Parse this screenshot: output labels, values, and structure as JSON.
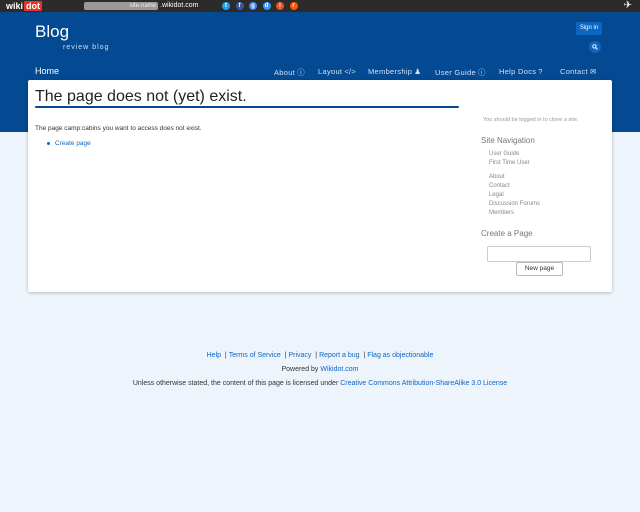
{
  "topbar": {
    "logo_wiki": "wiki",
    "logo_dot": "dot",
    "site_name_placeholder": "site-name",
    "domain_suffix": ".wikidot.com",
    "social_icons": [
      {
        "name": "twitter-icon",
        "color": "#1da1f2",
        "glyph": "t"
      },
      {
        "name": "facebook-icon",
        "color": "#3b5998",
        "glyph": "f"
      },
      {
        "name": "google-icon",
        "color": "#4285f4",
        "glyph": "g"
      },
      {
        "name": "delicious-icon",
        "color": "#3399ff",
        "glyph": "d"
      },
      {
        "name": "digg-icon",
        "color": "#e8532a",
        "glyph": "i"
      },
      {
        "name": "reddit-icon",
        "color": "#ff5700",
        "glyph": "r"
      }
    ]
  },
  "header": {
    "title": "Blog",
    "subtitle": "review blog",
    "signin_label": "Sign in",
    "accent": "#034a93"
  },
  "nav": {
    "home": "Home",
    "items": [
      {
        "label": "About",
        "icon": "info-icon",
        "glyph": "i"
      },
      {
        "label": "Layout",
        "icon": "code-icon",
        "glyph": "</>"
      },
      {
        "label": "Membership",
        "icon": "user-icon",
        "glyph": "♟"
      },
      {
        "label": "User Guide",
        "icon": "info-icon",
        "glyph": "i"
      },
      {
        "label": "Help Docs",
        "icon": "question-icon",
        "glyph": "?"
      },
      {
        "label": "Contact",
        "icon": "envelope-icon",
        "glyph": "✉"
      }
    ]
  },
  "main": {
    "title": "The page does not (yet) exist.",
    "body": "The page camp:cabins you want to access does not exist.",
    "create_link": "Create page"
  },
  "sidebar": {
    "login_note": "You should be logged in to clone a site.",
    "nav_heading": "Site Navigation",
    "links_group1": [
      "User Guide",
      "First Time User"
    ],
    "links_group2": [
      "About",
      "Contact",
      "Legal",
      "Discussion Forums",
      "Members"
    ],
    "create_heading": "Create a Page",
    "new_page_button": "New page"
  },
  "footer": {
    "links": [
      "Help",
      "Terms of Service",
      "Privacy",
      "Report a bug",
      "Flag as objectionable"
    ],
    "powered_prefix": "Powered by",
    "powered_link": "Wikidot.com",
    "license_prefix": "Unless otherwise stated, the content of this page is licensed under",
    "license_link": "Creative Commons Attribution-ShareAlike 3.0 License"
  }
}
